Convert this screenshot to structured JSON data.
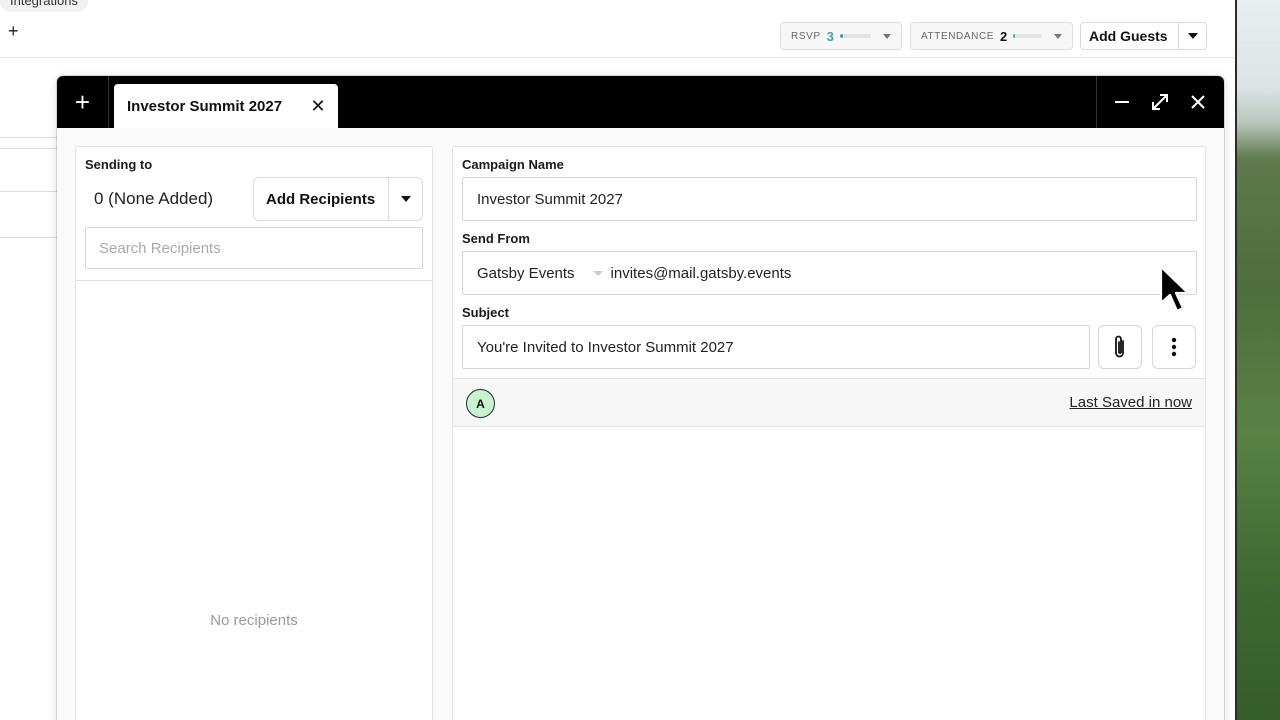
{
  "background_app": {
    "tab_label": "Integrations",
    "plus_label": "+",
    "stats": [
      {
        "label": "RSVP",
        "value": "3",
        "fill": 0.1,
        "color": "#3aa6a0"
      },
      {
        "label": "ATTENDANCE",
        "value": "2",
        "fill": 0.05,
        "color": "#3aa6a0"
      }
    ],
    "add_guests_label": "Add Guests"
  },
  "modal": {
    "new_tab_label": "+",
    "tab_title": "Investor Summit 2027",
    "close_tab_glyph": "✕",
    "controls": [
      "minimize-icon",
      "expand-icon",
      "close-icon"
    ]
  },
  "left_panel": {
    "sending_to_label": "Sending to",
    "recipient_count": "0 (None Added)",
    "add_recipients_label": "Add Recipients",
    "search_placeholder": "Search Recipients",
    "empty_text": "No recipients"
  },
  "right_panel": {
    "campaign_name_label": "Campaign Name",
    "campaign_name_value": "Investor Summit 2027",
    "send_from_label": "Send From",
    "send_from_name": "Gatsby Events",
    "send_from_email": "invites@mail.gatsby.events",
    "subject_label": "Subject",
    "subject_value": "You're Invited to Investor Summit 2027",
    "avatar_initial": "A",
    "last_saved": "Last Saved in now"
  },
  "colors": {
    "modal_bar": "#000000",
    "avatar_bg": "#c8f2cf",
    "accent": "#3aa6a0"
  }
}
